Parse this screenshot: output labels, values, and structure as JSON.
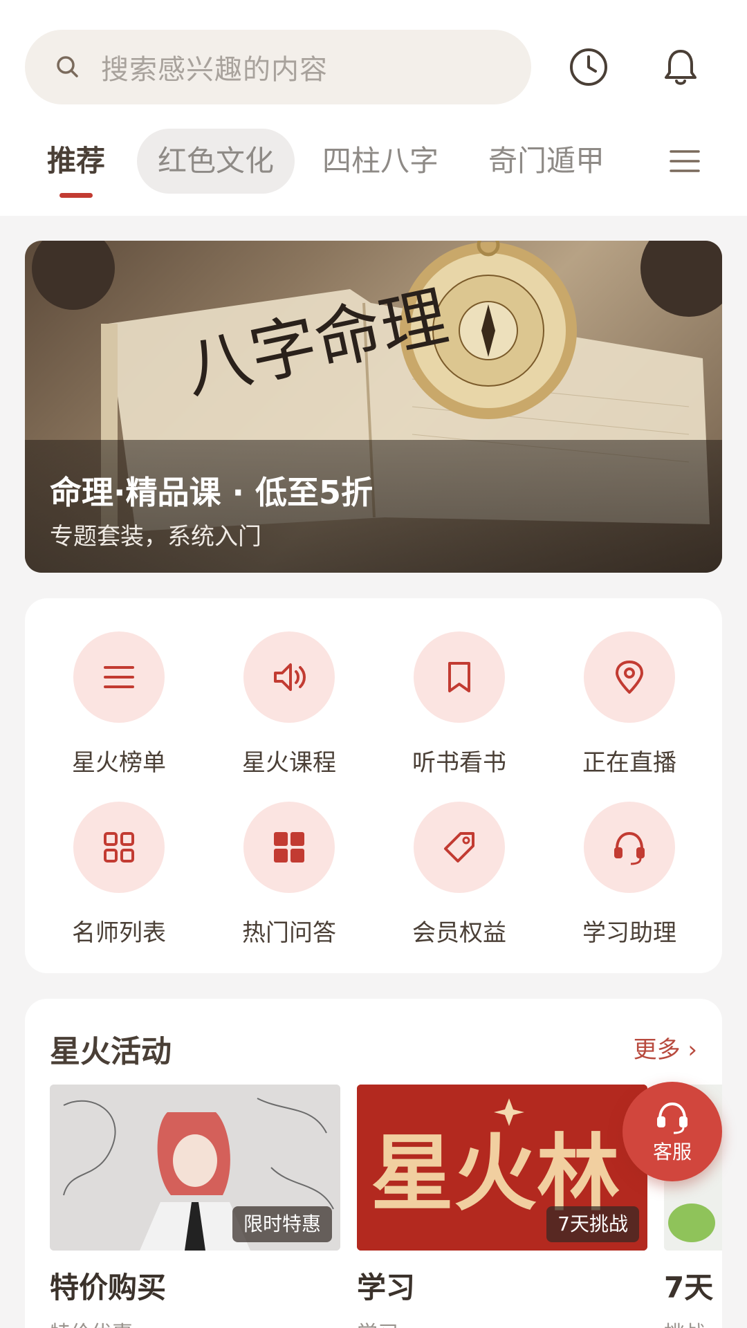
{
  "search": {
    "placeholder": "搜索感兴趣的内容"
  },
  "header": {
    "icons": [
      "clock-icon",
      "bell-icon"
    ]
  },
  "tabs": [
    {
      "label": "推荐",
      "active": true
    },
    {
      "label": "红色文化"
    },
    {
      "label": "四柱八字"
    },
    {
      "label": "奇门遁甲"
    }
  ],
  "banner": {
    "book_text": "八字命理",
    "title": "命理·精品课 · 低至5折",
    "subtitle": "专题套装，系统入门"
  },
  "quick_access": [
    {
      "label": "星火榜单",
      "icon": "list-icon"
    },
    {
      "label": "星火课程",
      "icon": "speaker-icon"
    },
    {
      "label": "听书看书",
      "icon": "bookmark-icon"
    },
    {
      "label": "正在直播",
      "icon": "location-pin-icon"
    },
    {
      "label": "名师列表",
      "icon": "grid-outline-icon"
    },
    {
      "label": "热门问答",
      "icon": "grid-filled-icon"
    },
    {
      "label": "会员权益",
      "icon": "tag-icon"
    },
    {
      "label": "学习助理",
      "icon": "headset-icon"
    }
  ],
  "activity": {
    "title": "星火活动",
    "more": "更多 ›",
    "cards": [
      {
        "title": "特价购买",
        "subtitle": "特价优惠",
        "tag": "限时特惠"
      },
      {
        "title": "学习",
        "subtitle": "学习",
        "tag": "7天挑战",
        "image_text": "星火林"
      },
      {
        "title": "7天",
        "subtitle": "挑战"
      }
    ]
  },
  "service": {
    "label": "客服"
  },
  "colors": {
    "accent": "#c23b32",
    "icon_bg": "#fbe4e1",
    "service": "#d1463d"
  }
}
